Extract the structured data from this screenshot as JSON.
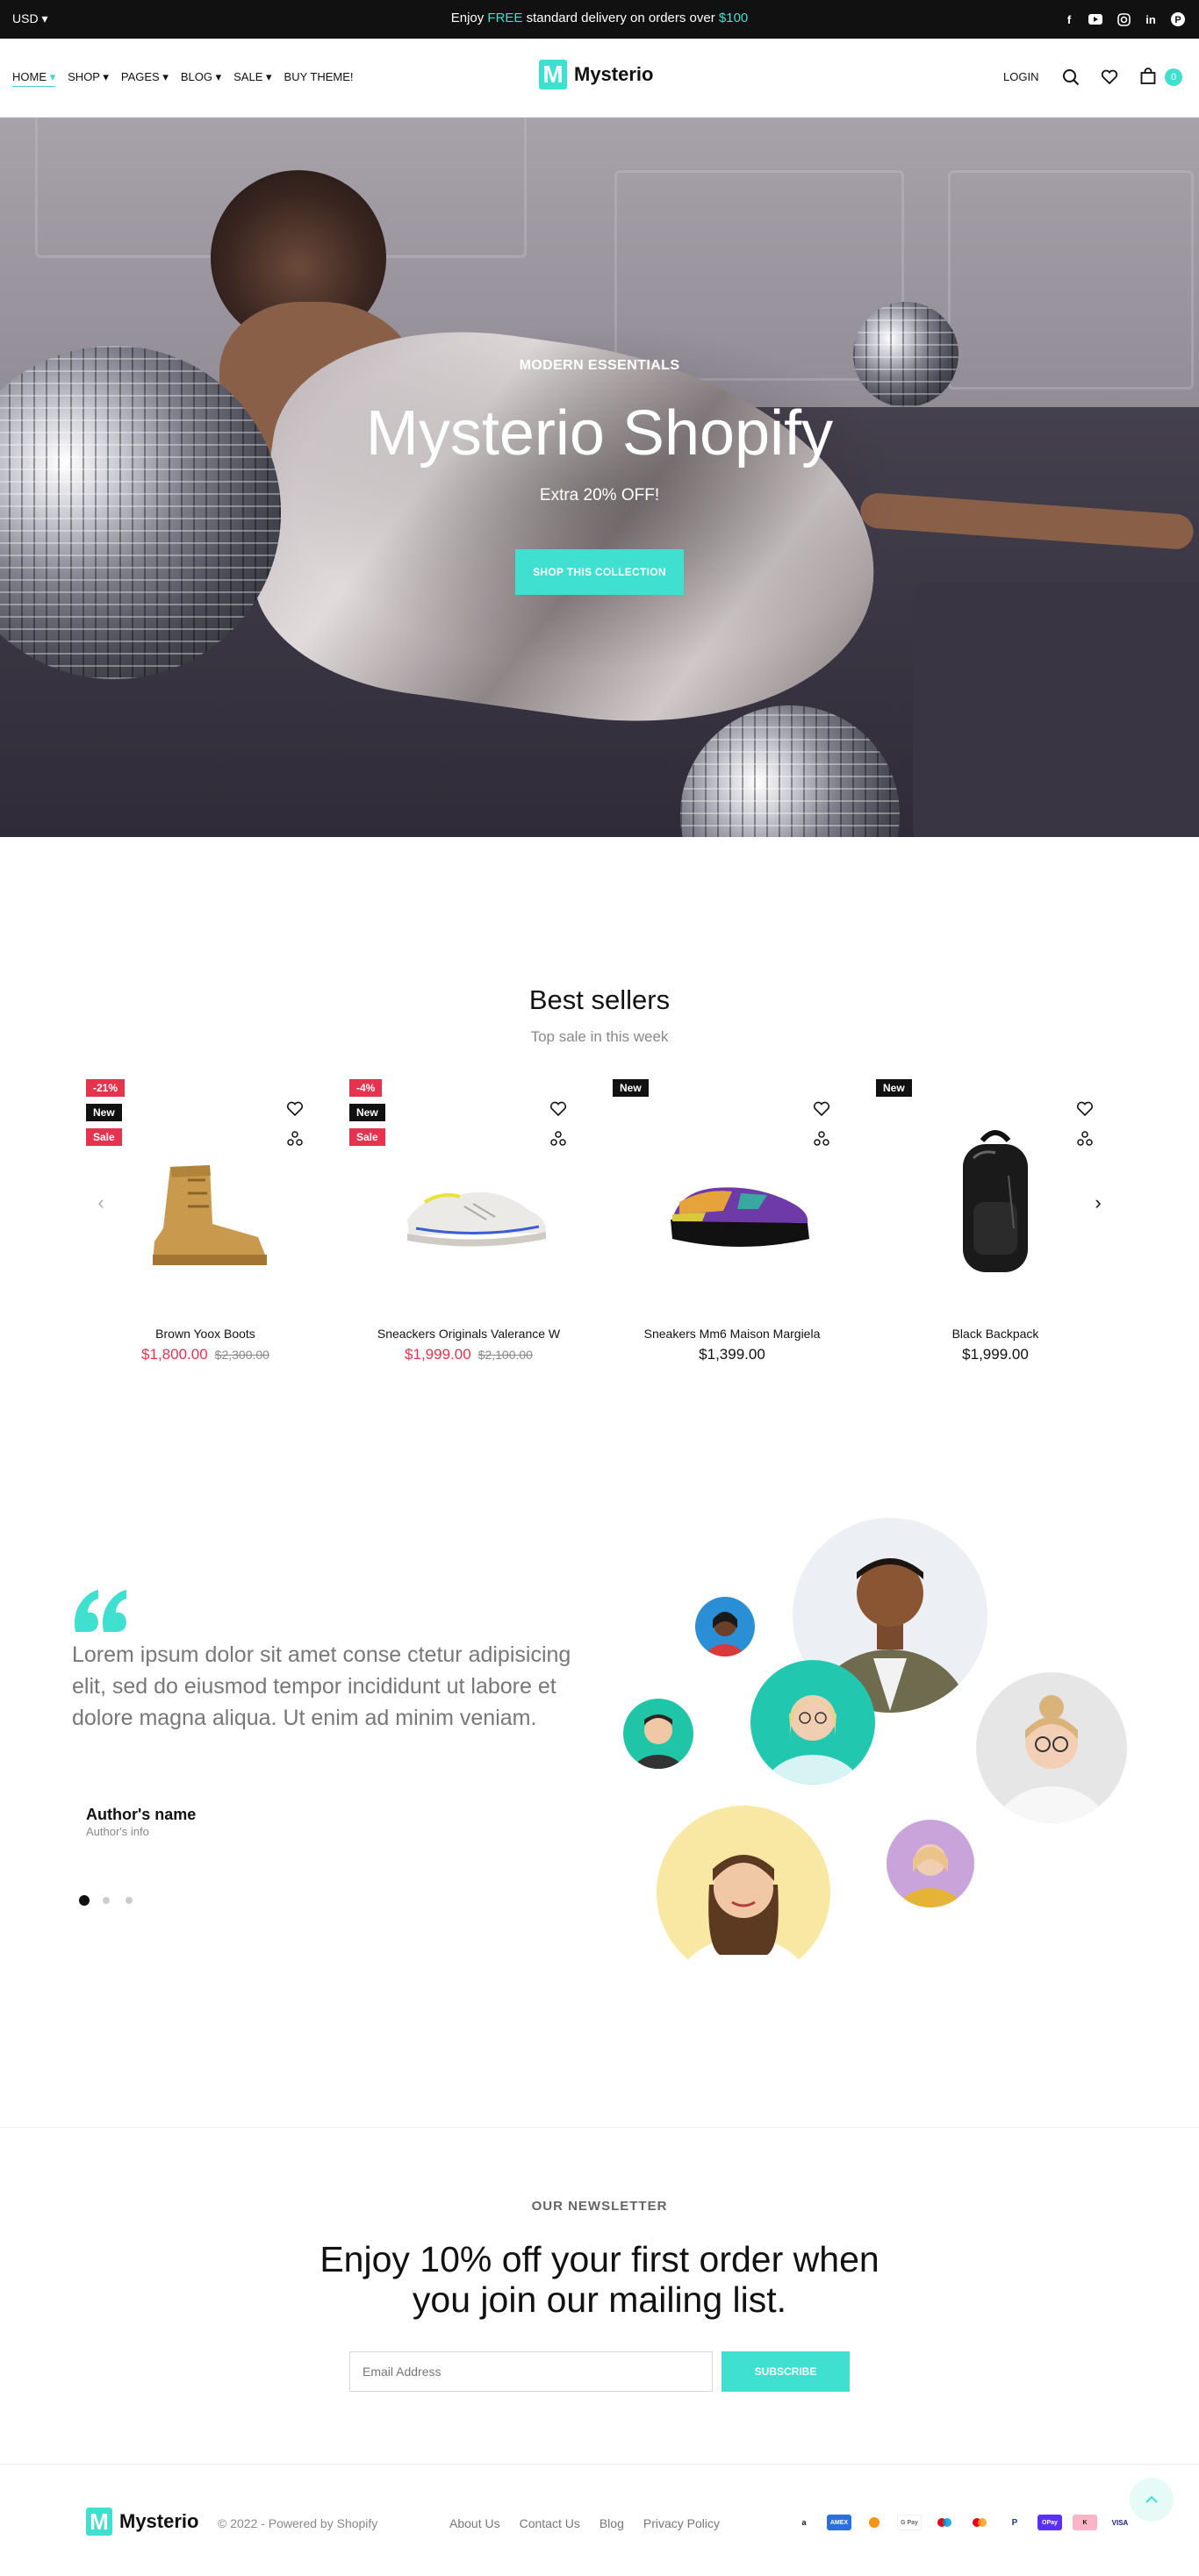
{
  "topbar": {
    "currency": "USD",
    "message_pre": "Enjoy ",
    "message_free": "FREE",
    "message_mid": " standard delivery on orders over ",
    "message_amount": "$100",
    "social": [
      "facebook-icon",
      "youtube-icon",
      "instagram-icon",
      "linkedin-icon",
      "pinterest-icon"
    ]
  },
  "header": {
    "nav": [
      "HOME",
      "SHOP",
      "PAGES",
      "BLOG",
      "SALE",
      "BUY THEME!"
    ],
    "logo_letter": "M",
    "logo_text": "Mysterio",
    "login": "LOGIN",
    "cart_count": "0"
  },
  "hero": {
    "eyebrow": "MODERN ESSENTIALS",
    "title": "Mysterio Shopify",
    "subtitle": "Extra 20% OFF!",
    "cta": "SHOP THIS COLLECTION"
  },
  "bestsellers": {
    "title": "Best sellers",
    "subtitle": "Top sale in this week",
    "products": [
      {
        "name": "Brown Yoox Boots",
        "price": "$1,800.00",
        "old_price": "$2,300.00",
        "badges": [
          "-21%",
          "New",
          "Sale"
        ]
      },
      {
        "name": "Sneackers Originals Valerance W",
        "price": "$1,999.00",
        "old_price": "$2,100.00",
        "badges": [
          "-4%",
          "New",
          "Sale"
        ]
      },
      {
        "name": "Sneakers Mm6 Maison Margiela",
        "price": "$1,399.00",
        "old_price": "",
        "badges": [
          "New"
        ]
      },
      {
        "name": "Black Backpack",
        "price": "$1,999.00",
        "old_price": "",
        "badges": [
          "New"
        ]
      }
    ]
  },
  "testimonial": {
    "quote": "Lorem ipsum dolor sit amet conse ctetur adipisicing elit, sed do eiusmod tempor incididunt ut labore et dolore magna aliqua. Ut enim ad minim veniam.",
    "author": "Author's name",
    "author_info": "Author's info"
  },
  "newsletter": {
    "eyebrow": "OUR NEWSLETTER",
    "title_line1": "Enjoy 10% off your first order when",
    "title_line2": "you join our mailing list.",
    "placeholder": "Email Address",
    "button": "SUBSCRIBE"
  },
  "footer": {
    "logo_text": "Mysterio",
    "copyright": "© 2022 - Powered by Shopify",
    "links": [
      "About Us",
      "Contact Us",
      "Blog",
      "Privacy Policy"
    ],
    "payments": [
      "amazon",
      "amex",
      "bitcoin",
      "G Pay",
      "maestro",
      "mastercard",
      "PayPal",
      "OPay",
      "klarna",
      "VISA"
    ]
  },
  "colors": {
    "accent": "#3fe0d0",
    "sale": "#e5334e",
    "dark": "#111111"
  }
}
